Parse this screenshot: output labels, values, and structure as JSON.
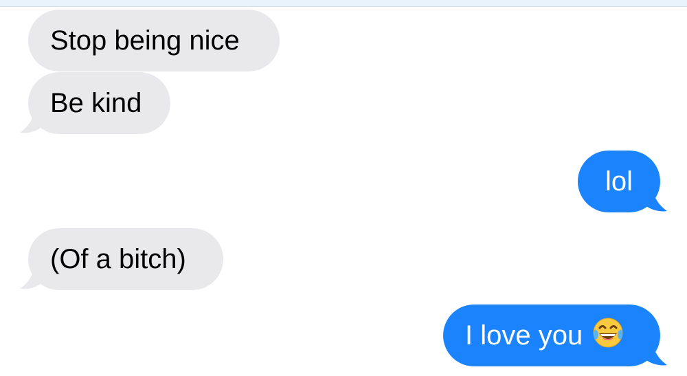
{
  "colors": {
    "sent_bubble": "#1b84fd",
    "received_bubble": "#e9e9eb",
    "sent_text": "#ffffff",
    "received_text": "#000000"
  },
  "messages": [
    {
      "direction": "received",
      "text": "Stop being nice"
    },
    {
      "direction": "received",
      "text": "Be kind"
    },
    {
      "direction": "sent",
      "text": "lol"
    },
    {
      "direction": "received",
      "text": "(Of a bitch)"
    },
    {
      "direction": "sent",
      "text": "I love you",
      "emoji": "face-with-tears-of-joy-icon"
    }
  ]
}
